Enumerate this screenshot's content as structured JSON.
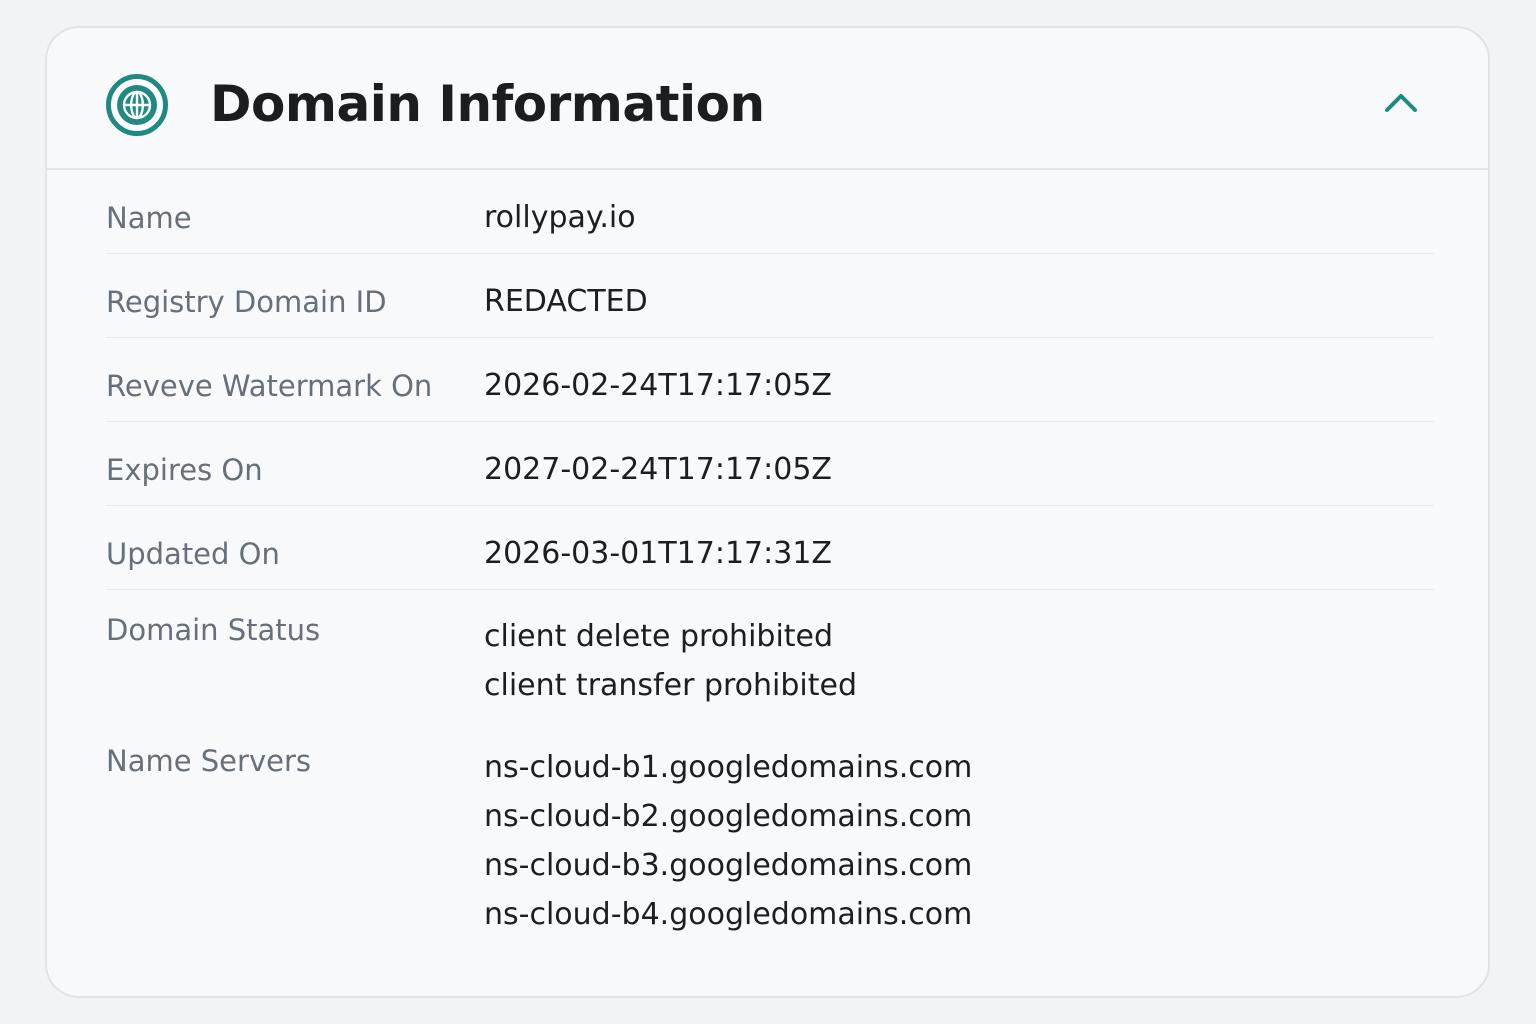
{
  "panel": {
    "title": "Domain Information",
    "icon": "globe-icon",
    "toggle_icon": "chevron-up-icon",
    "accent_color": "#1f8a83"
  },
  "fields": {
    "name": {
      "label": "Name",
      "value": "rollypay.io"
    },
    "registry_domain_id": {
      "label": "Registry Domain ID",
      "value": "REDACTED"
    },
    "registered_on": {
      "label": "Reveve Watermark On",
      "value": "2026-02-24T17:17:05Z"
    },
    "expires_on": {
      "label": "Expires On",
      "value": "2027-02-24T17:17:05Z"
    },
    "updated_on": {
      "label": "Updated On",
      "value": "2026-03-01T17:17:31Z"
    },
    "domain_status": {
      "label": "Domain Status",
      "values": [
        "client delete prohibited",
        "client transfer prohibited"
      ]
    },
    "name_servers": {
      "label": "Name Servers",
      "values": [
        "ns-cloud-b1.googledomains.com",
        "ns-cloud-b2.googledomains.com",
        "ns-cloud-b3.googledomains.com",
        "ns-cloud-b4.googledomains.com"
      ]
    }
  }
}
